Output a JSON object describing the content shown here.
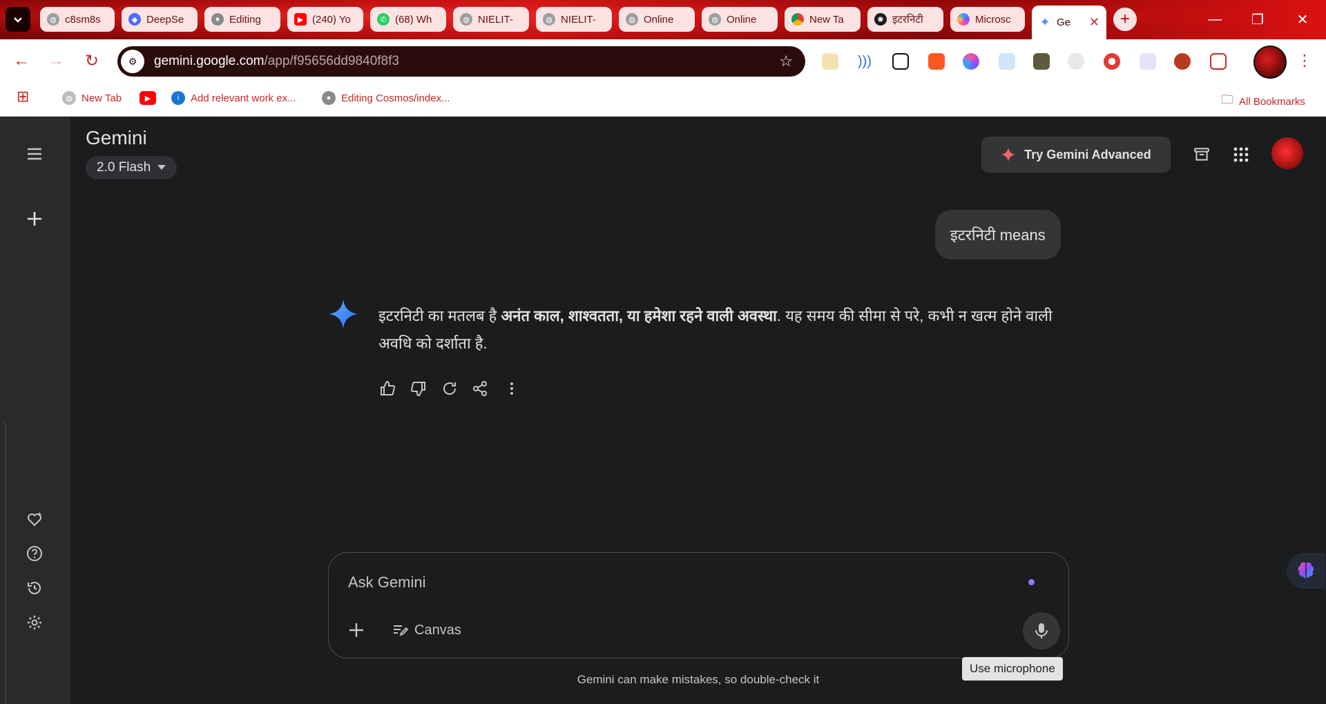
{
  "browser": {
    "tabs": [
      {
        "label": "c8sm8s",
        "icon": "globe-icon"
      },
      {
        "label": "DeepSe",
        "icon": "deepseek-whale-icon"
      },
      {
        "label": "Editing",
        "icon": "github-icon"
      },
      {
        "label": "(240) Yo",
        "icon": "youtube-icon"
      },
      {
        "label": "(68) Wh",
        "icon": "whatsapp-icon"
      },
      {
        "label": "NIELIT-",
        "icon": "globe-icon"
      },
      {
        "label": "NIELIT-",
        "icon": "globe-icon"
      },
      {
        "label": "Online",
        "icon": "globe-icon"
      },
      {
        "label": "Online",
        "icon": "globe-icon"
      },
      {
        "label": "New Ta",
        "icon": "chrome-icon"
      },
      {
        "label": "इटरनिटी",
        "icon": "chatgpt-icon"
      },
      {
        "label": "Microsc",
        "icon": "copilot-icon"
      },
      {
        "label": "Ge",
        "icon": "gemini-spark-icon"
      }
    ],
    "url_host": "gemini.google.com",
    "url_path": "/app/f95656dd9840f8f3",
    "bookmarks": [
      {
        "label": "New Tab"
      },
      {
        "label": ""
      },
      {
        "label": "Add relevant work ex..."
      },
      {
        "label": "Editing Cosmos/index..."
      }
    ],
    "all_bookmarks": "All Bookmarks"
  },
  "app": {
    "title": "Gemini",
    "model": "2.0 Flash",
    "try_advanced": "Try Gemini Advanced"
  },
  "chat": {
    "user_message": "इटरनिटी means",
    "answer_parts": [
      {
        "text": "इटरनिटी का मतलब है ",
        "bold": false
      },
      {
        "text": "अनंत काल, शाश्वतता, या हमेशा रहने वाली अवस्था",
        "bold": true
      },
      {
        "text": ". यह समय की सीमा से परे, कभी न खत्म होने वाली अवधि को दर्शाता है.",
        "bold": false
      }
    ]
  },
  "composer": {
    "placeholder": "Ask Gemini",
    "canvas_label": "Canvas",
    "mic_tooltip": "Use microphone",
    "disclaimer": "Gemini can make mistakes, so double-check it"
  },
  "colors": {
    "accent_red": "#c62828",
    "app_bg": "#1b1c1d",
    "rail_bg": "#282a2c",
    "gemini_blue": "#4e8cf5"
  }
}
